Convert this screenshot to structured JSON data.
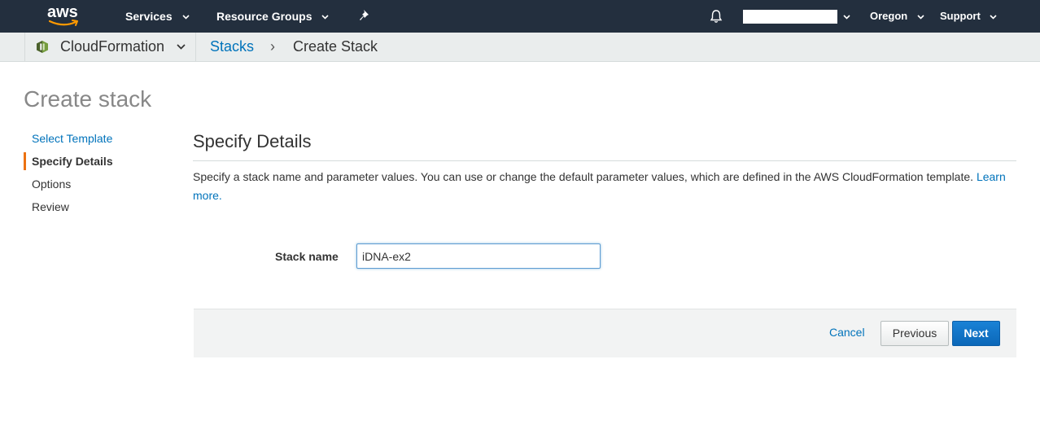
{
  "topnav": {
    "logo": "aws",
    "services_label": "Services",
    "resource_groups_label": "Resource Groups",
    "pin_icon": "pin-icon",
    "bell_icon": "bell-icon",
    "region_label": "Oregon",
    "support_label": "Support"
  },
  "servicebar": {
    "service_icon": "cloudformation-icon",
    "service_name": "CloudFormation",
    "breadcrumb": [
      "Stacks",
      "Create Stack"
    ],
    "separator": "›"
  },
  "page": {
    "title": "Create stack",
    "steps": [
      {
        "label": "Select Template",
        "state": "link"
      },
      {
        "label": "Specify Details",
        "state": "active"
      },
      {
        "label": "Options",
        "state": "pending"
      },
      {
        "label": "Review",
        "state": "pending"
      }
    ]
  },
  "details": {
    "title": "Specify Details",
    "description": "Specify a stack name and parameter values. You can use or change the default parameter values, which are defined in the AWS CloudFormation template.",
    "learn_more": "Learn more.",
    "stack_name_label": "Stack name",
    "stack_name_value": "iDNA-ex2"
  },
  "footer": {
    "cancel_label": "Cancel",
    "previous_label": "Previous",
    "next_label": "Next"
  },
  "colors": {
    "nav_bg": "#232f3e",
    "link": "#0073bb",
    "active_step_marker": "#ec7211",
    "primary_button": "#0b67b8"
  }
}
